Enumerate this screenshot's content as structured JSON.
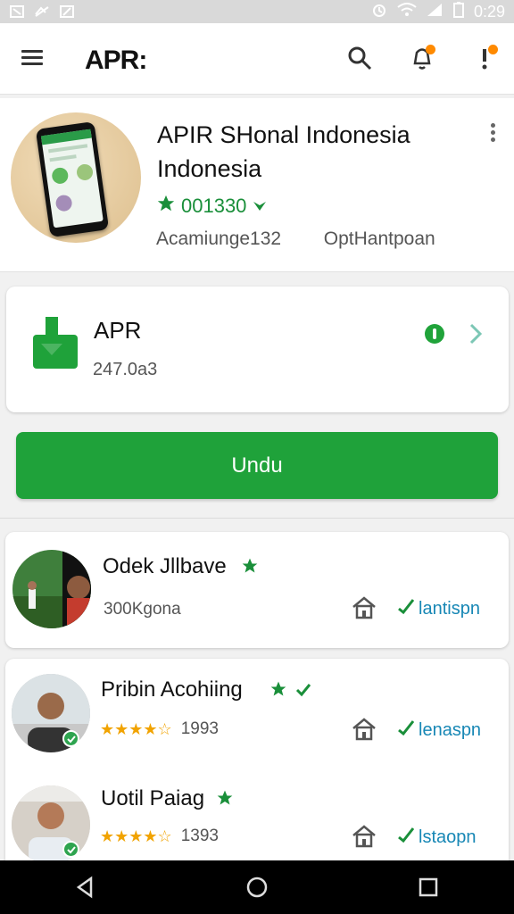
{
  "status_bar": {
    "time": "0:29"
  },
  "top_bar": {
    "logo_text": "APR:"
  },
  "app_header": {
    "title": "APIR SHonal Indonesia Indonesia",
    "rating_text": "001330",
    "meta_left": "Acamiunge132",
    "meta_right": "OptHantpoan"
  },
  "download_card": {
    "title": "APR",
    "size_text": "247.0a3"
  },
  "download_button": {
    "label": "Undu"
  },
  "developers": {
    "items": [
      {
        "name": "Odek Jllbave",
        "sub": "300Kgona",
        "action": "lantispn"
      },
      {
        "name": "Pribin Acohiing",
        "rating": "1993",
        "action": "lenaspn"
      },
      {
        "name": "Uotil Paiag",
        "rating": "1393",
        "action": "lstaopn"
      }
    ]
  },
  "colors": {
    "accent_green": "#1fa23a",
    "link_blue": "#1787b5",
    "star_orange": "#f1a300"
  }
}
